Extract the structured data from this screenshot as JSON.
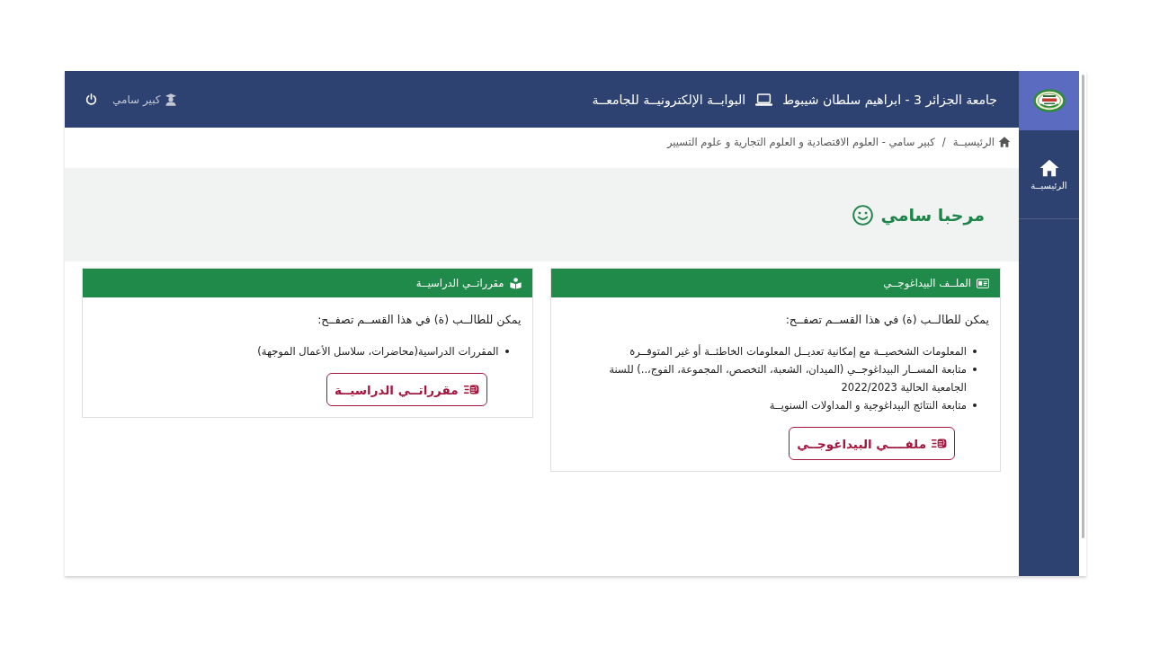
{
  "header": {
    "university": "جامعة الجزائر 3 - ابراهيم سلطان شيبوط",
    "portal": "البوابــة الإلكترونيــة للجامعــة",
    "user": "كبير سامي"
  },
  "sidebar": {
    "items": [
      {
        "label": "الرئيسيــة",
        "selected": false
      }
    ]
  },
  "breadcrumb": {
    "items": [
      "الرئيسيــة",
      "كبير سامي - العلوم الاقتصادية و العلوم التجارية و علوم التسيير"
    ],
    "separator": "/"
  },
  "welcome": "مرحبا سامي",
  "cards": [
    {
      "kind": "profile",
      "title": "الملــف البيداغوجــي",
      "intro": "يمكن للطالــب (ة) في هذا القســم تصفــح:",
      "items": [
        "المعلومات الشخصيــة مع إمكانية تعديــل المعلومات الخاطئــة أو غير المتوفــرة",
        "متابعة المســار البيداغوجــي (الميدان، الشعبة، التخصص، المجموعة، الفوج،..) للسنة الجامعية الحالية 2022/2023",
        "متابعة النتائج البيداغوجية و المداولات السنويــة"
      ],
      "button": "ملفــــي البيداغوجــي"
    },
    {
      "kind": "courses",
      "title": "مقرراتــي الدراسيــة",
      "intro": "يمكن للطالــب (ة) في هذا القســم تصفــح:",
      "items": [
        "المقررات الدراسية(محاضرات، سلاسل الأعمال الموجهة)"
      ],
      "button": "مقرراتــي الدراسيــة"
    }
  ]
}
